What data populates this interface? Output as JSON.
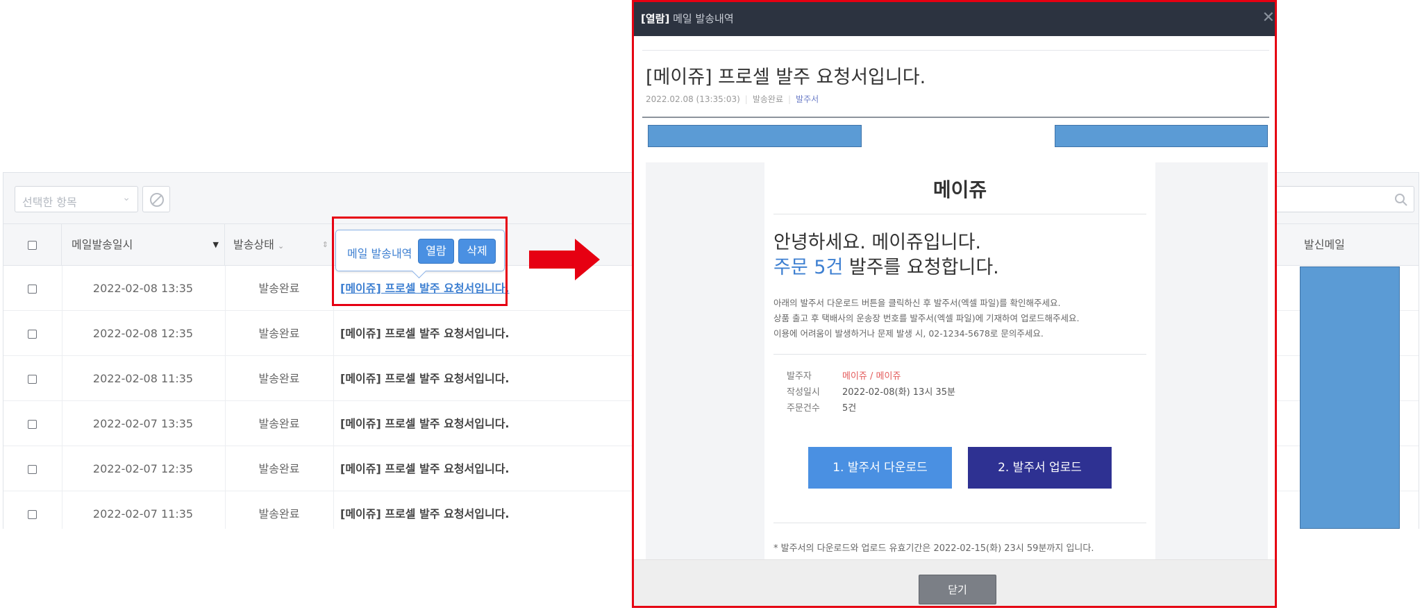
{
  "toolbar": {
    "bulk_select_placeholder": "선택한 항목",
    "chevron_icon": "chevron-down-icon",
    "cancel_icon": "ban-icon",
    "search_icon": "search-icon"
  },
  "table": {
    "headers": {
      "date": "메일발송일시",
      "status": "발송상태",
      "sender": "발신메일"
    },
    "rows": [
      {
        "date": "2022-02-08 13:35",
        "status": "발송완료",
        "subject": "[메이쥬] 프로셀 발주 요청서입니다."
      },
      {
        "date": "2022-02-08 12:35",
        "status": "발송완료",
        "subject": "[메이쥬] 프로셀 발주 요청서입니다."
      },
      {
        "date": "2022-02-08 11:35",
        "status": "발송완료",
        "subject": "[메이쥬] 프로셀 발주 요청서입니다."
      },
      {
        "date": "2022-02-07 13:35",
        "status": "발송완료",
        "subject": "[메이쥬] 프로셀 발주 요청서입니다."
      },
      {
        "date": "2022-02-07 12:35",
        "status": "발송완료",
        "subject": "[메이쥬] 프로셀 발주 요청서입니다."
      },
      {
        "date": "2022-02-07 11:35",
        "status": "발송완료",
        "subject": "[메이쥬] 프로셀 발주 요청서입니다."
      }
    ]
  },
  "tooltip": {
    "label": "메일 발송내역",
    "view_label": "열람",
    "delete_label": "삭제"
  },
  "colors": {
    "highlight": "#e60012",
    "accent": "#4a90e2",
    "header_dark": "#2c3340",
    "upload_button": "#2e3192"
  },
  "modal": {
    "title_prefix": "[열람]",
    "title": "메일 발송내역",
    "close_icon": "close-icon",
    "subject": "[메이쥬] 프로셀 발주 요청서입니다.",
    "sent_at": "2022.02.08 (13:35:03)",
    "status": "발송완료",
    "attachment": "발주서",
    "email": {
      "brand": "메이쥬",
      "greeting_line1": "안녕하세요. 메이쥬입니다.",
      "greeting_highlight": "주문 5건",
      "greeting_line2_rest": " 발주를 요청합니다.",
      "instructions": [
        "아래의 발주서 다운로드 버튼을 클릭하신 후 발주서(엑셀 파일)를 확인해주세요.",
        "상품 출고 후 택배사의 운송장 번호를 발주서(엑셀 파일)에 기재하여 업로드해주세요.",
        "이용에 어려움이 발생하거나 문제 발생 시, 02-1234-5678로 문의주세요."
      ],
      "info": {
        "orderer_label": "발주자",
        "orderer_value": "메이쥬 / 메이쥬",
        "created_label": "작성일시",
        "created_value": "2022-02-08(화) 13시 35분",
        "count_label": "주문건수",
        "count_value": "5건"
      },
      "download_button": "1. 발주서 다운로드",
      "upload_button": "2. 발주서 업로드",
      "notice": "* 발주서의 다운로드와 업로드 유효기간은 2022-02-15(화) 23시 59분까지 입니다."
    },
    "close_button": "닫기"
  }
}
